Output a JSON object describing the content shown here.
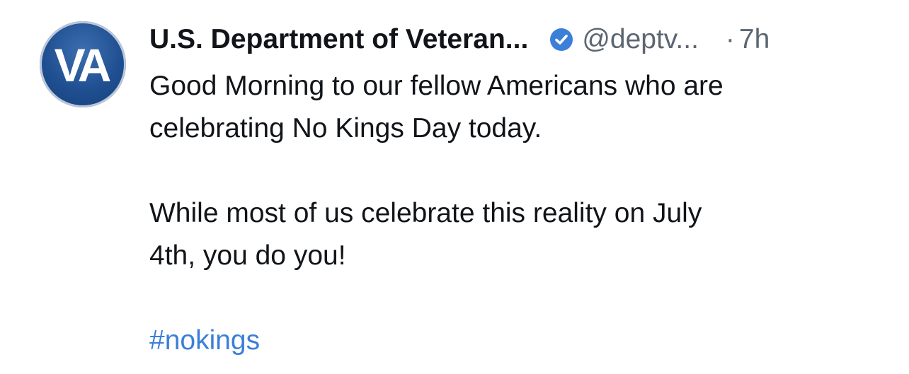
{
  "post": {
    "avatar_text": "VA",
    "display_name": "U.S. Department of Veteran...",
    "handle": "@deptv...",
    "separator": "·",
    "time": "7h",
    "paragraph_1_line_1": "Good Morning to our fellow Americans who are",
    "paragraph_1_line_2": "celebrating No Kings Day today.",
    "paragraph_2_line_1": "While most of us celebrate this reality on July",
    "paragraph_2_line_2": "4th, you do you!",
    "hashtag": "#nokings"
  },
  "icons": {
    "verified": "verified-badge-icon"
  },
  "colors": {
    "text": "#111418",
    "secondary": "#5b6671",
    "link": "#3b7fd8",
    "verified": "#3b7fd8",
    "avatar_bg": "#1f4f91"
  }
}
